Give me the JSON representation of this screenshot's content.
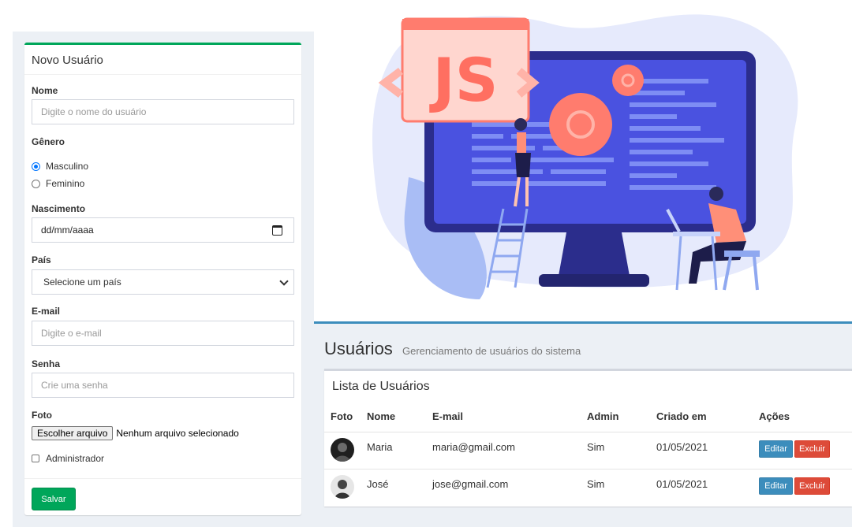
{
  "form": {
    "title": "Novo Usuário",
    "name_label": "Nome",
    "name_placeholder": "Digite o nome do usuário",
    "gender_label": "Gênero",
    "gender_options": [
      "Masculino",
      "Feminino"
    ],
    "gender_selected": "Masculino",
    "birth_label": "Nascimento",
    "birth_placeholder": "dd/mm/aaaa",
    "country_label": "País",
    "country_selected": "Selecione um país",
    "email_label": "E-mail",
    "email_placeholder": "Digite o e-mail",
    "password_label": "Senha",
    "password_placeholder": "Crie uma senha",
    "photo_label": "Foto",
    "file_button": "Escolher arquivo",
    "file_status": "Nenhum arquivo selecionado",
    "admin_label": "Administrador",
    "admin_checked": false,
    "save_button": "Salvar"
  },
  "illustration": {
    "badge_text": "JS"
  },
  "users": {
    "title": "Usuários",
    "subtitle": "Gerenciamento de usuários do sistema",
    "list_title": "Lista de Usuários",
    "columns": [
      "Foto",
      "Nome",
      "E-mail",
      "Admin",
      "Criado em",
      "Ações"
    ],
    "rows": [
      {
        "name": "Maria",
        "email": "maria@gmail.com",
        "admin": "Sim",
        "created": "01/05/2021",
        "edit": "Editar",
        "delete": "Excluir"
      },
      {
        "name": "José",
        "email": "jose@gmail.com",
        "admin": "Sim",
        "created": "01/05/2021",
        "edit": "Editar",
        "delete": "Excluir"
      }
    ]
  },
  "colors": {
    "success": "#00a65a",
    "primary": "#3c8dbc",
    "danger": "#dd4b39",
    "background": "#ecf0f5"
  }
}
